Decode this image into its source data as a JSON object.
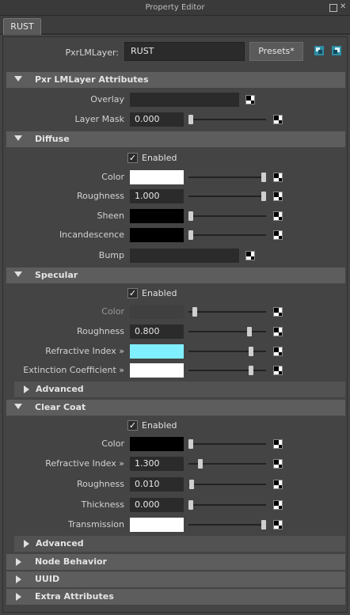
{
  "window": {
    "title": "Property Editor"
  },
  "tab": {
    "label": "RUST"
  },
  "layer": {
    "label": "PxrLMLayer:",
    "value": "RUST",
    "presets_label": "Presets*"
  },
  "sections": {
    "pxr": {
      "title": "Pxr  LMLayer Attributes",
      "overlay_label": "Overlay",
      "layer_mask_label": "Layer Mask",
      "layer_mask_value": "0.000"
    },
    "diffuse": {
      "title": "Diffuse",
      "enabled_label": "Enabled",
      "color_label": "Color",
      "roughness_label": "Roughness",
      "roughness_value": "1.000",
      "sheen_label": "Sheen",
      "incandescence_label": "Incandescence",
      "bump_label": "Bump"
    },
    "specular": {
      "title": "Specular",
      "enabled_label": "Enabled",
      "color_label": "Color",
      "roughness_label": "Roughness",
      "roughness_value": "0.800",
      "refractive_label": "Refractive Index »",
      "extinction_label": "Extinction Coefficient »",
      "advanced_label": "Advanced"
    },
    "clearcoat": {
      "title": "Clear Coat",
      "enabled_label": "Enabled",
      "color_label": "Color",
      "refractive_label": "Refractive Index »",
      "refractive_value": "1.300",
      "roughness_label": "Roughness",
      "roughness_value": "0.010",
      "thickness_label": "Thickness",
      "thickness_value": "0.000",
      "transmission_label": "Transmission",
      "advanced_label": "Advanced"
    },
    "node_behavior": {
      "title": "Node Behavior"
    },
    "uuid": {
      "title": "UUID"
    },
    "extra": {
      "title": "Extra Attributes"
    }
  },
  "slider_levels": {
    "layer_mask": 0.0,
    "diffuse_color": 1.0,
    "diffuse_roughness": 1.0,
    "diffuse_sheen": 0.0,
    "diffuse_incandescence": 0.0,
    "specular_color": 0.05,
    "specular_roughness": 0.8,
    "specular_refractive": 0.83,
    "specular_extinction": 0.83,
    "clearcoat_color": 0.0,
    "clearcoat_refractive": 0.13,
    "clearcoat_roughness": 0.01,
    "clearcoat_thickness": 0.0,
    "clearcoat_transmission": 1.0
  },
  "colors": {
    "diffuse_color": "#ffffff",
    "diffuse_sheen": "#000000",
    "diffuse_incandescence": "#000000",
    "specular_color": "#404040",
    "specular_refractive": "#80f0ff",
    "specular_extinction": "#ffffff",
    "clearcoat_color": "#000000",
    "clearcoat_transmission": "#ffffff"
  }
}
